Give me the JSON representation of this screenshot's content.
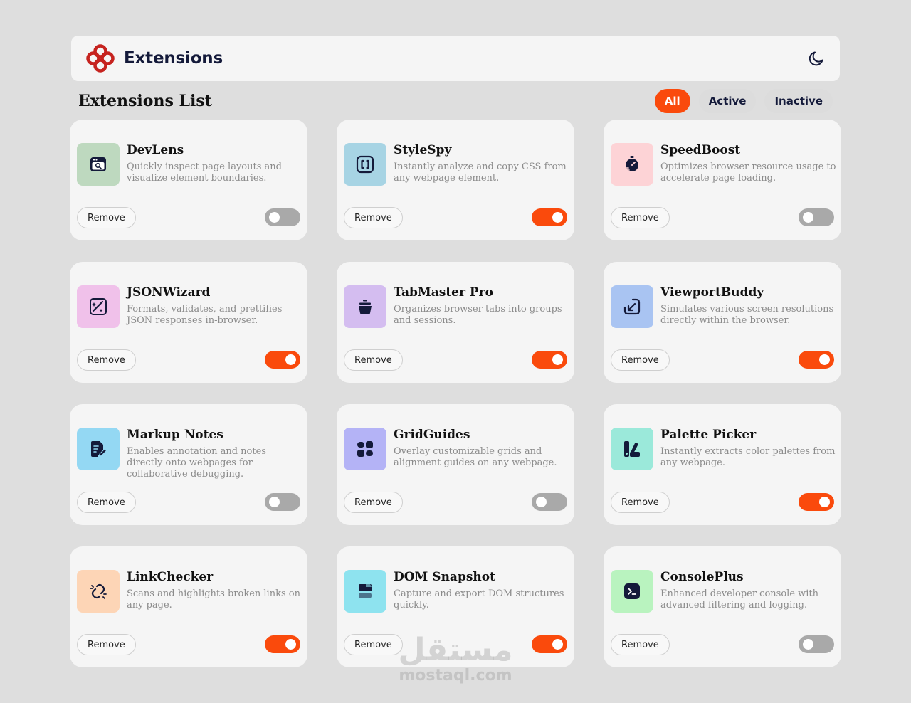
{
  "header": {
    "app_name": "Extensions",
    "logo_icon": "knot-logo-icon",
    "theme_icon": "moon-icon"
  },
  "list": {
    "title": "Extensions List",
    "filters": [
      {
        "label": "All",
        "active": true
      },
      {
        "label": "Active",
        "active": false
      },
      {
        "label": "Inactive",
        "active": false
      }
    ]
  },
  "colors": {
    "accent": "#fa4a0c",
    "toggle_off": "#a9a9a9",
    "card_bg": "#f5f5f5",
    "page_bg": "#dedede",
    "navy": "#141a3a"
  },
  "extensions": [
    {
      "name": "DevLens",
      "description": "Quickly inspect page layouts and visualize element boundaries.",
      "icon": "browser-search-icon",
      "icon_bg": "#bed9bf",
      "active": false,
      "remove_label": "Remove"
    },
    {
      "name": "StyleSpy",
      "description": "Instantly analyze and copy CSS from any webpage element.",
      "icon": "brackets-icon",
      "icon_bg": "#a7d4e4",
      "active": true,
      "remove_label": "Remove"
    },
    {
      "name": "SpeedBoost",
      "description": "Optimizes browser resource usage to accelerate page loading.",
      "icon": "stopwatch-icon",
      "icon_bg": "#fdd3d6",
      "active": false,
      "remove_label": "Remove"
    },
    {
      "name": "JSONWizard",
      "description": "Formats, validates, and prettifies JSON responses in-browser.",
      "icon": "magic-image-icon",
      "icon_bg": "#f0c1ea",
      "active": true,
      "remove_label": "Remove"
    },
    {
      "name": "TabMaster Pro",
      "description": "Organizes browser tabs into groups and sessions.",
      "icon": "stack-pot-icon",
      "icon_bg": "#d4bdf0",
      "active": true,
      "remove_label": "Remove"
    },
    {
      "name": "ViewportBuddy",
      "description": "Simulates various screen resolutions directly within the browser.",
      "icon": "resize-arrow-icon",
      "icon_bg": "#a9c4f2",
      "active": true,
      "remove_label": "Remove"
    },
    {
      "name": "Markup Notes",
      "description": "Enables annotation and notes directly onto webpages for collaborative debugging.",
      "icon": "note-pen-icon",
      "icon_bg": "#94d8f3",
      "active": false,
      "remove_label": "Remove"
    },
    {
      "name": "GridGuides",
      "description": "Overlay customizable grids and alignment guides on any webpage.",
      "icon": "grid-icon",
      "icon_bg": "#b4b3f6",
      "active": false,
      "remove_label": "Remove"
    },
    {
      "name": "Palette Picker",
      "description": "Instantly extracts color palettes from any webpage.",
      "icon": "palette-icon",
      "icon_bg": "#9be9da",
      "active": true,
      "remove_label": "Remove"
    },
    {
      "name": "LinkChecker",
      "description": "Scans and highlights broken links on any page.",
      "icon": "broken-link-icon",
      "icon_bg": "#fdd5b6",
      "active": true,
      "remove_label": "Remove"
    },
    {
      "name": "DOM Snapshot",
      "description": "Capture and export DOM structures quickly.",
      "icon": "layers-icon",
      "icon_bg": "#8ee3ef",
      "active": true,
      "remove_label": "Remove"
    },
    {
      "name": "ConsolePlus",
      "description": "Enhanced developer console with advanced filtering and logging.",
      "icon": "terminal-icon",
      "icon_bg": "#b9f3bf",
      "active": false,
      "remove_label": "Remove"
    }
  ],
  "watermark": {
    "arabic": "مستقل",
    "latin": "mostaql.com"
  }
}
